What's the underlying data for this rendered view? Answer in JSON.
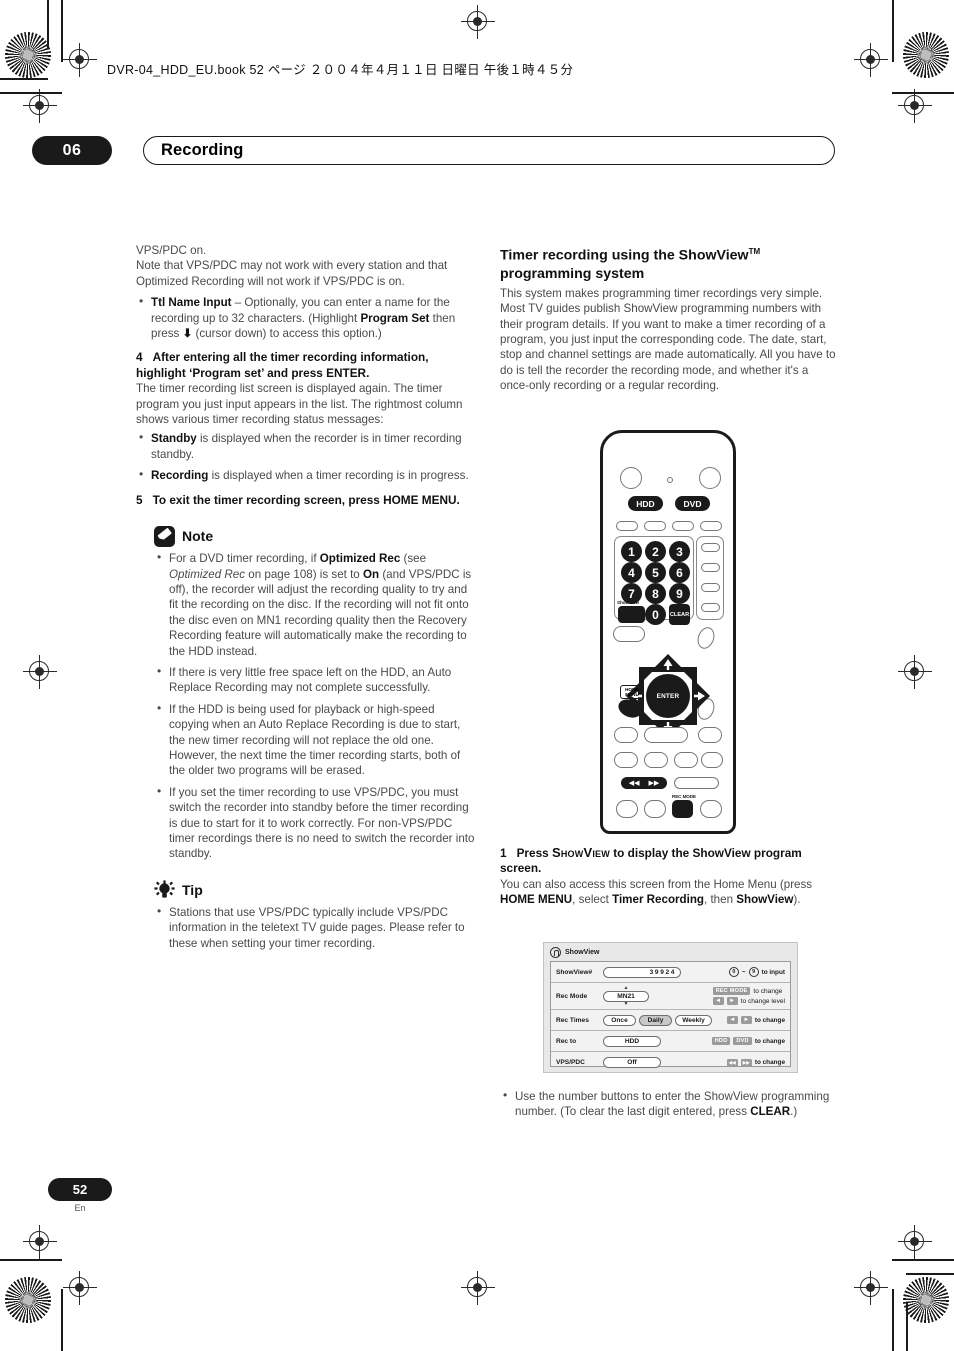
{
  "running_head": "DVR-04_HDD_EU.book  52 ページ  ２００４年４月１１日  日曜日  午後１時４５分",
  "chapter": {
    "number": "06",
    "title": "Recording"
  },
  "footer": {
    "page_number": "52",
    "language": "En"
  },
  "left_column": {
    "intro": "VPS/PDC on.",
    "intro2": "Note that VPS/PDC may not work with every station and that Optimized Recording will not work if VPS/PDC is on.",
    "bullet_ttl_bold": "Ttl Name Input",
    "bullet_ttl_rest1": " – Optionally, you can enter a name for the recording up to 32 characters. (Highlight ",
    "bullet_ttl_bold2": "Program Set",
    "bullet_ttl_rest2": " then press ",
    "bullet_ttl_arrow": "⬇",
    "bullet_ttl_rest3": " (cursor down) to access this option.)",
    "step4_num": "4",
    "step4_text": "After entering all the timer recording information, highlight ‘Program set’ and press ENTER.",
    "step4_body": "The timer recording list screen is displayed again. The timer program you just input appears in the list. The rightmost column shows various timer recording status messages:",
    "status_standby_bold": "Standby",
    "status_standby_rest": " is displayed when the recorder is in timer recording standby.",
    "status_recording_bold": "Recording",
    "status_recording_rest": " is displayed when a timer recording is in progress.",
    "step5_num": "5",
    "step5_text": "To exit the timer recording screen, press HOME MENU.",
    "note": {
      "label": "Note",
      "icon": "pencil-note-icon",
      "items": [
        {
          "parts": [
            {
              "t": "For a DVD timer recording, if ",
              "s": "n"
            },
            {
              "t": "Optimized Rec",
              "s": "b"
            },
            {
              "t": " (see ",
              "s": "n"
            },
            {
              "t": "Optimized Rec",
              "s": "i"
            },
            {
              "t": " on page 108) is set to ",
              "s": "n"
            },
            {
              "t": "On",
              "s": "b"
            },
            {
              "t": " (and VPS/PDC is off), the recorder will adjust the recording quality to try and fit the recording on the disc. If the recording will not fit onto the disc even on MN1 recording quality then the Recovery Recording feature will automatically make the recording to the HDD instead.",
              "s": "n"
            }
          ]
        },
        {
          "parts": [
            {
              "t": "If there is very little free space left on the HDD, an Auto Replace Recording may not complete successfully.",
              "s": "n"
            }
          ]
        },
        {
          "parts": [
            {
              "t": "If the HDD is being used for playback or high-speed copying when an Auto Replace Recording is due to start, the new timer recording will not replace the old one. However, the next time the timer recording starts, both of the older two programs will be erased.",
              "s": "n"
            }
          ]
        },
        {
          "parts": [
            {
              "t": "If you set the timer recording to use VPS/PDC, you must switch the recorder into standby before the timer recording is due to start for it to work correctly. For non-VPS/PDC timer recordings there is no need to switch the recorder into standby.",
              "s": "n"
            }
          ]
        }
      ]
    },
    "tip": {
      "label": "Tip",
      "icon": "lightbulb-tip-icon",
      "items": [
        {
          "parts": [
            {
              "t": "Stations that use VPS/PDC typically include VPS/PDC information in the teletext TV guide pages. Please refer to these when setting your timer recording.",
              "s": "n"
            }
          ]
        }
      ]
    }
  },
  "right_column": {
    "heading_line1": "Timer recording using the ShowView",
    "heading_tm": "TM",
    "heading_line2": "programming system",
    "intro": "This system makes programming timer recordings very simple. Most TV guides publish ShowView programming numbers with their program details. If you want to make a timer recording of a program, you just input the corresponding code. The date, start, stop and channel settings are made automatically. All you have to do is tell the recorder the recording mode, and whether it's a once-only recording or a regular recording.",
    "step1_num": "1",
    "step1_press": "Press ",
    "step1_showview_key": "ShowView",
    "step1_rest": " to display the ShowView program screen.",
    "step1_body": {
      "parts": [
        {
          "t": "You can also access this screen from the Home Menu (press ",
          "s": "n"
        },
        {
          "t": "HOME MENU",
          "s": "b"
        },
        {
          "t": ", select ",
          "s": "n"
        },
        {
          "t": "Timer Recording",
          "s": "b"
        },
        {
          "t": ", then ",
          "s": "n"
        },
        {
          "t": "ShowView",
          "s": "b"
        },
        {
          "t": ").",
          "s": "n"
        }
      ]
    },
    "final_bullet": {
      "parts": [
        {
          "t": "Use the number buttons to enter the ShowView programming number. (To clear the last digit entered, press ",
          "s": "n"
        },
        {
          "t": "CLEAR",
          "s": "b"
        },
        {
          "t": ".)",
          "s": "n"
        }
      ]
    }
  },
  "remote": {
    "name": "remote-control-illustration",
    "hdd_button": "HDD",
    "dvd_button": "DVD",
    "number_keys": [
      "1",
      "2",
      "3",
      "4",
      "5",
      "6",
      "7",
      "8",
      "9",
      "0"
    ],
    "clear_button": "CLEAR",
    "showview_label": "ShowView",
    "home_menu_label_line1": "HOME",
    "home_menu_label_line2": "MENU",
    "enter_button": "ENTER",
    "rec_mode_label": "REC MODE",
    "skip_back": "◀◀",
    "skip_fwd": "▶▶"
  },
  "osd": {
    "title": "ShowView",
    "rows": [
      {
        "label": "ShowView#",
        "value": "39924",
        "hint_keys": [
          "0",
          "9"
        ],
        "hint_text": "to input"
      },
      {
        "label": "Rec Mode",
        "value": "MN21",
        "hint_chip": "REC MODE",
        "hint_text": "to change",
        "hint_text2": "to change level"
      },
      {
        "label": "Rec Times",
        "options": [
          "Once",
          "Daily",
          "Weekly"
        ],
        "selected": "Daily",
        "hint_text": "to change"
      },
      {
        "label": "Rec to",
        "value": "HDD",
        "hint_chips": [
          "HDD",
          "DVD"
        ],
        "hint_text": "to change"
      },
      {
        "label": "VPS/PDC",
        "value": "Off",
        "hint_text": "to change"
      }
    ]
  }
}
